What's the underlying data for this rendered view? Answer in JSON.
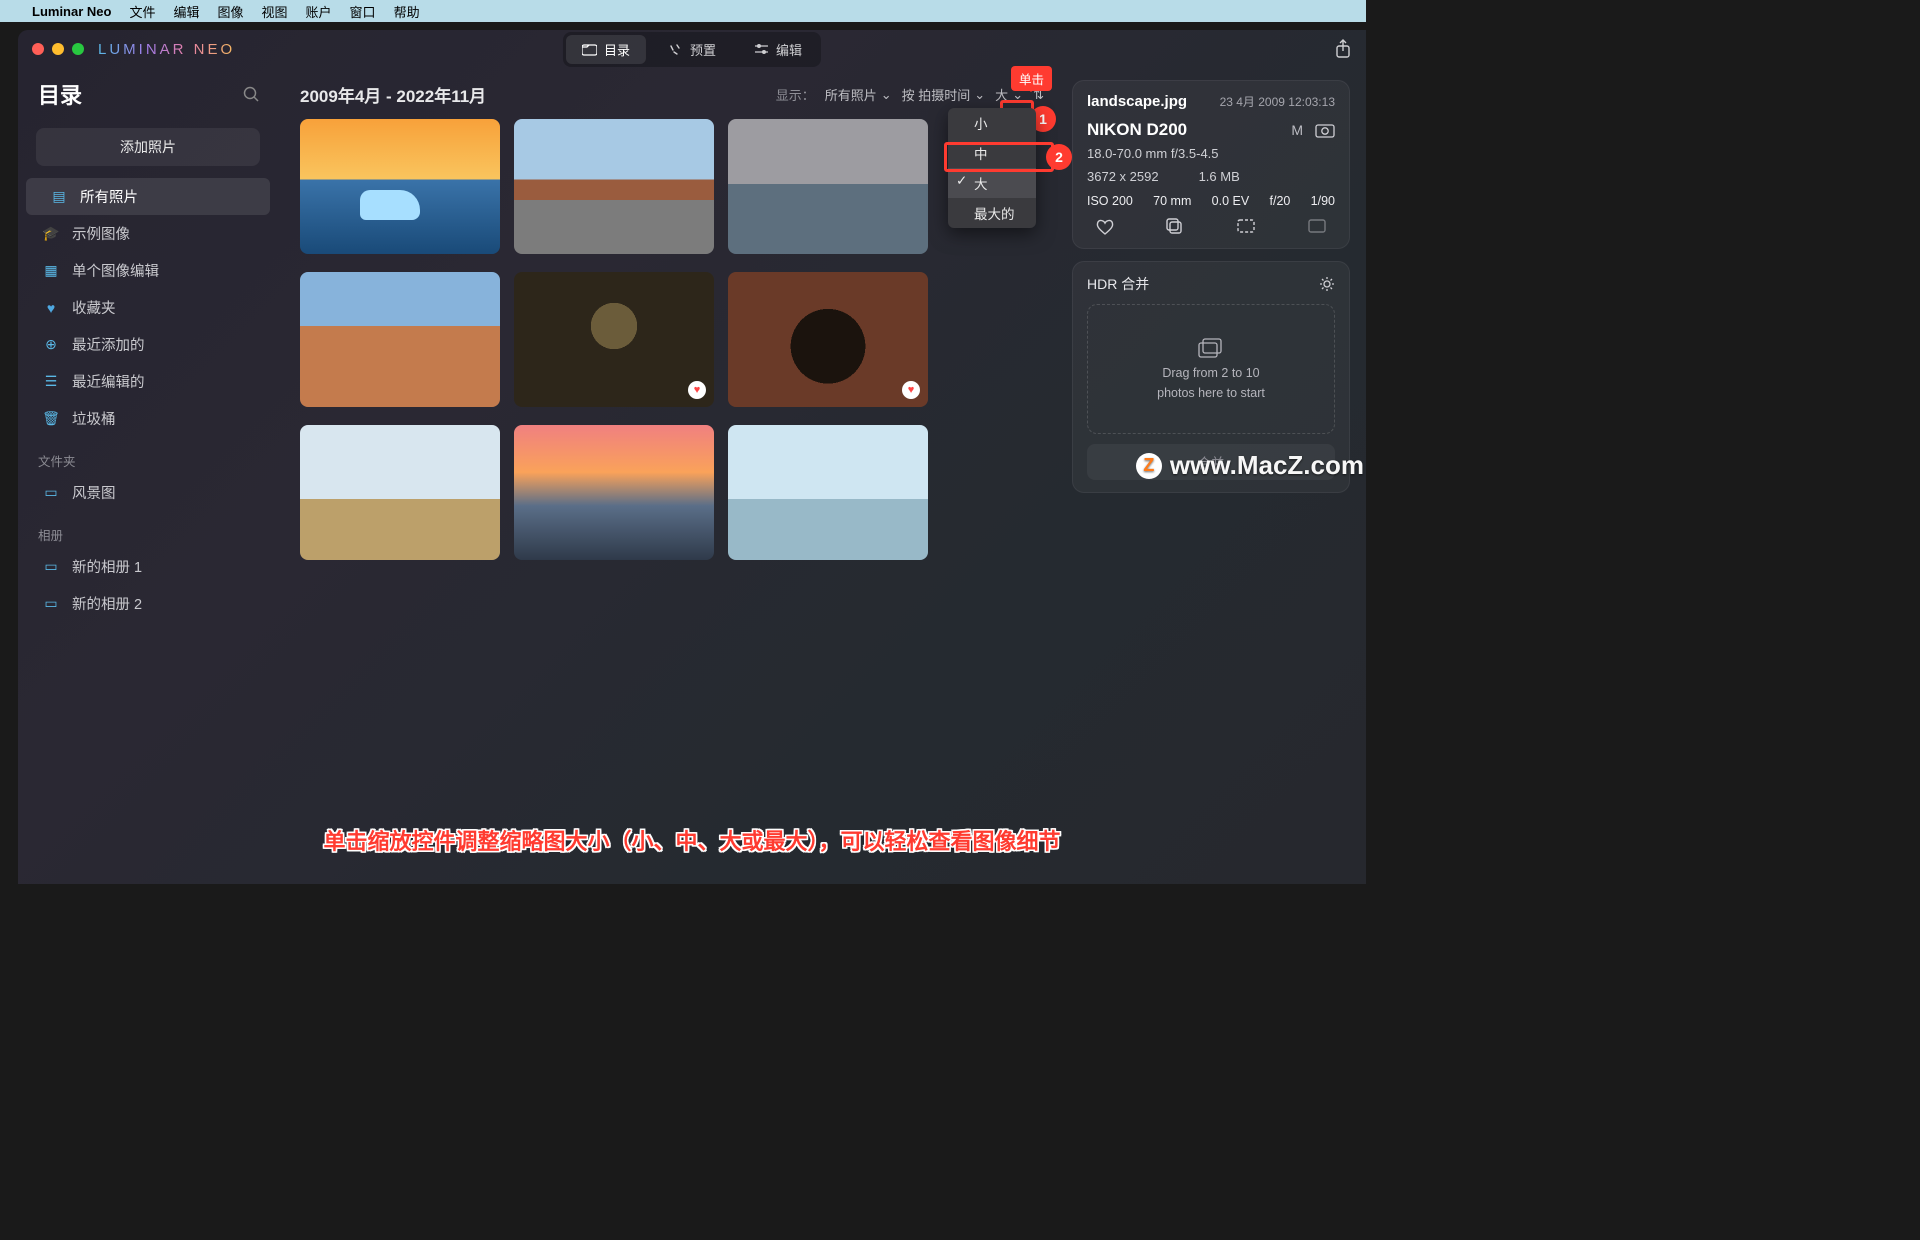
{
  "menubar": {
    "app_name": "Luminar Neo",
    "items": [
      "文件",
      "编辑",
      "图像",
      "视图",
      "账户",
      "窗口",
      "帮助"
    ]
  },
  "brand": "LUMINAR NEO",
  "top_tabs": {
    "catalog": "目录",
    "presets": "预置",
    "edit": "编辑"
  },
  "sidebar": {
    "title": "目录",
    "add_photos": "添加照片",
    "items": [
      {
        "icon": "catalog-icon",
        "label": "所有照片",
        "active": true
      },
      {
        "icon": "grad-cap-icon",
        "label": "示例图像"
      },
      {
        "icon": "grid-icon",
        "label": "单个图像编辑"
      },
      {
        "icon": "heart-icon",
        "label": "收藏夹"
      },
      {
        "icon": "plus-circle-icon",
        "label": "最近添加的"
      },
      {
        "icon": "sliders-icon",
        "label": "最近编辑的"
      },
      {
        "icon": "trash-icon",
        "label": "垃圾桶"
      }
    ],
    "folders_label": "文件夹",
    "folders": [
      {
        "label": "风景图"
      }
    ],
    "albums_label": "相册",
    "albums": [
      {
        "label": "新的相册 1"
      },
      {
        "label": "新的相册 2"
      }
    ]
  },
  "main": {
    "date_range": "2009年4月 - 2022年11月",
    "show_label": "显示：",
    "filter_all": "所有照片",
    "sort_by": "按 拍摄时间",
    "size": "大",
    "size_options": [
      "小",
      "中",
      "大",
      "最大的"
    ]
  },
  "info": {
    "filename": "landscape.jpg",
    "datetime": "23 4月 2009 12:03:13",
    "camera": "NIKON D200",
    "mode": "M",
    "lens": "18.0-70.0 mm f/3.5-4.5",
    "dimensions": "3672 x 2592",
    "filesize": "1.6 MB",
    "iso": "ISO 200",
    "focal": "70 mm",
    "ev": "0.0 EV",
    "aperture": "f/20",
    "shutter": "1/90"
  },
  "hdr": {
    "title": "HDR 合并",
    "drop_line1": "Drag from 2 to 10",
    "drop_line2": "photos here to start",
    "merge": "合并"
  },
  "annotation": {
    "callout": "单击",
    "badge1": "1",
    "badge2": "2",
    "footer": "单击缩放控件调整缩略图大小（小、中、大或最大），可以轻松查看图像细节"
  },
  "watermark": "www.MacZ.com"
}
